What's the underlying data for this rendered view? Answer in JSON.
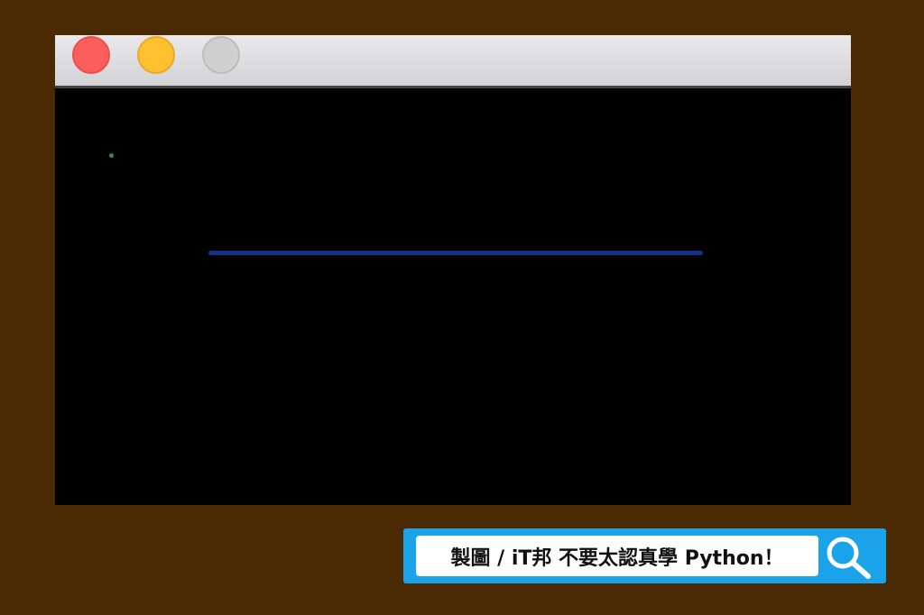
{
  "window": {
    "buttons": [
      {
        "name": "close-button",
        "color": "#fc5f5b"
      },
      {
        "name": "minimize-button",
        "color": "#fec02f"
      },
      {
        "name": "zoom-button",
        "color": "#cfcfcf"
      }
    ]
  },
  "game": {
    "background": "#000000",
    "ball_color": "#2e8b57",
    "paddle_color": "#14308a"
  },
  "banner": {
    "text": "製圖 / iT邦 不要太認真學 Python！",
    "accent": "#1aa3e8",
    "icon": "search-icon"
  }
}
